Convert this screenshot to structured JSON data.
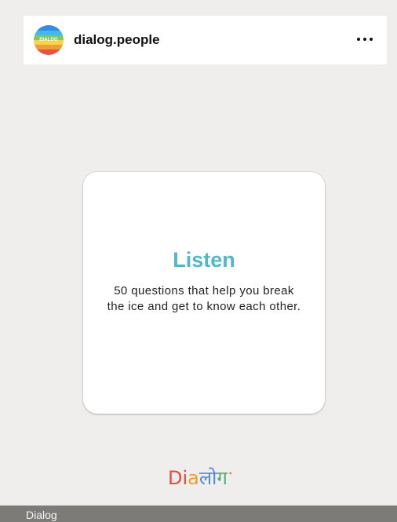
{
  "post": {
    "username": "dialog.people",
    "avatar_text": "DIALOG",
    "more_icon": "more-horizontal-icon"
  },
  "card": {
    "title": "Listen",
    "description": "50 questions that help you break the ice and get to know each other."
  },
  "brand": {
    "parts": [
      "Di",
      "a",
      "लो",
      "ग",
      "ॱ"
    ]
  },
  "footer": {
    "label": "Dialog"
  },
  "colors": {
    "background": "#f0eeec",
    "card_title": "#52b7c7",
    "footer_bar": "#7d7b78"
  }
}
